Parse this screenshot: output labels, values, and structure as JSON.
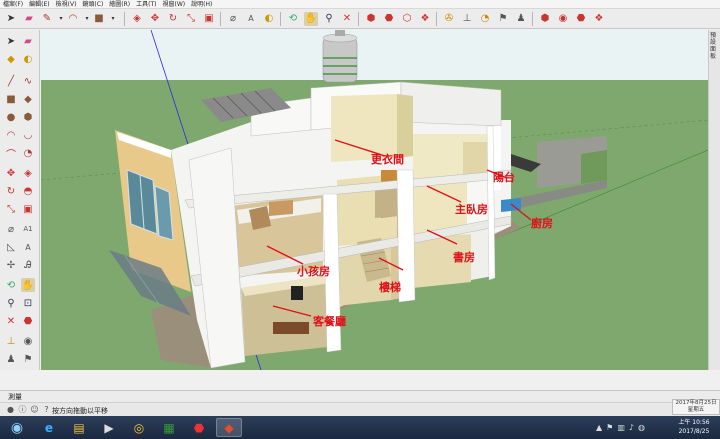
{
  "menu": {
    "items": [
      "檔案(F)",
      "編輯(E)",
      "檢視(V)",
      "鏡頭(C)",
      "繪圖(R)",
      "工具(T)",
      "視窗(W)",
      "說明(H)"
    ]
  },
  "tray": {
    "label": "預設面板"
  },
  "viewport": {
    "rooms": {
      "r1": "陽台",
      "r2": "更衣間",
      "r3": "主臥房",
      "r4": "廚房",
      "r5": "小孩房",
      "r6": "書房",
      "r7": "樓梯",
      "r8": "客餐廳"
    }
  },
  "status": {
    "measure_label": "測量",
    "hint": "按方向拖動以平移",
    "date_line1": "2017年8月25日",
    "date_line2": "星期五"
  },
  "taskbar": {
    "time_line1": "上午 10:56",
    "time_line2": "2017/8/25"
  },
  "colors": {
    "sky": "#eaf3f3",
    "ground": "#7fa86e",
    "accent_red": "#e0101a"
  }
}
